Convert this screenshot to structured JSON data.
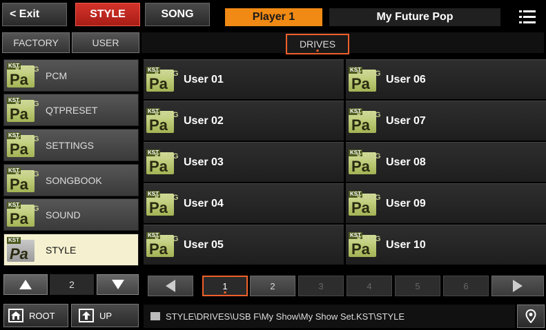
{
  "topbar": {
    "exit_label": "< Exit",
    "tab_style": "STYLE",
    "tab_song": "SONG",
    "player": "Player 1",
    "performance_name": "My Future Pop"
  },
  "subbar": {
    "factory": "FACTORY",
    "user": "USER",
    "drives": "DRIVES"
  },
  "sidebar": {
    "items": [
      {
        "label": "PCM"
      },
      {
        "label": "QTPRESET"
      },
      {
        "label": "SETTINGS"
      },
      {
        "label": "SONGBOOK"
      },
      {
        "label": "SOUND"
      },
      {
        "label": "STYLE",
        "selected": true
      }
    ],
    "page": "2"
  },
  "icon": {
    "kst": "KST",
    "korg": "KORG",
    "pa": "Pa"
  },
  "grid": {
    "left": [
      {
        "label": "User 01"
      },
      {
        "label": "User 02"
      },
      {
        "label": "User 03"
      },
      {
        "label": "User 04"
      },
      {
        "label": "User 05"
      }
    ],
    "right": [
      {
        "label": "User 06"
      },
      {
        "label": "User 07"
      },
      {
        "label": "User 08"
      },
      {
        "label": "User 09"
      },
      {
        "label": "User 10"
      }
    ]
  },
  "pager": {
    "pages": [
      "1",
      "2",
      "3",
      "4",
      "5",
      "6"
    ],
    "current": "1"
  },
  "bottom": {
    "root": "ROOT",
    "up": "UP",
    "path": "STYLE\\DRIVES\\USB F\\My Show\\My Show Set.KST\\STYLE"
  },
  "colors": {
    "accent": "#f0602a",
    "player_bg": "#f08a14",
    "style_tab": "#c0271f",
    "selected_item": "#f5f1d0"
  }
}
